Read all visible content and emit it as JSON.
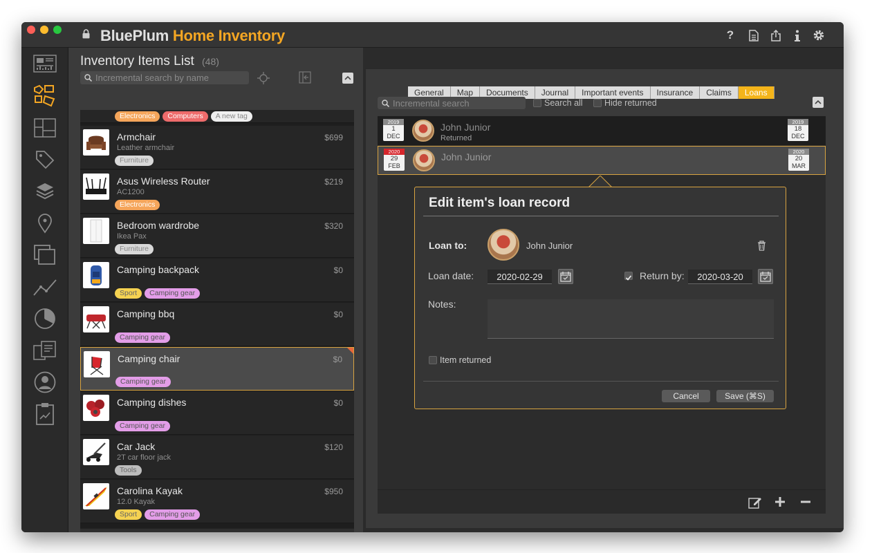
{
  "app": {
    "title_brand": "BluePlum",
    "title_product": "Home Inventory"
  },
  "toolbar": {
    "help_icon": "?"
  },
  "left": {
    "title": "Inventory Items List",
    "count": "(48)",
    "search_placeholder": "Incremental search by name",
    "top_tags": [
      "Electronics",
      "Computers",
      "A new tag"
    ],
    "items": [
      {
        "name": "Armchair",
        "sub": "Leather armchair",
        "price": "$699",
        "tags": [
          "Furniture"
        ]
      },
      {
        "name": "Asus Wireless Router",
        "sub": "AC1200",
        "price": "$219",
        "tags": [
          "Electronics"
        ]
      },
      {
        "name": "Bedroom wardrobe",
        "sub": "Ikea Pax",
        "price": "$320",
        "tags": [
          "Furniture"
        ]
      },
      {
        "name": "Camping backpack",
        "sub": "",
        "price": "$0",
        "tags": [
          "Sport",
          "Camping gear"
        ]
      },
      {
        "name": "Camping bbq",
        "sub": "",
        "price": "$0",
        "tags": [
          "Camping gear"
        ]
      },
      {
        "name": "Camping chair",
        "sub": "",
        "price": "$0",
        "tags": [
          "Camping gear"
        ]
      },
      {
        "name": "Camping dishes",
        "sub": "",
        "price": "$0",
        "tags": [
          "Camping gear"
        ]
      },
      {
        "name": "Car Jack",
        "sub": "2T car floor jack",
        "price": "$120",
        "tags": [
          "Tools"
        ]
      },
      {
        "name": "Carolina Kayak",
        "sub": "12.0 Kayak",
        "price": "$950",
        "tags": [
          "Sport",
          "Camping gear"
        ]
      }
    ]
  },
  "tabs": [
    "General",
    "Map",
    "Documents",
    "Journal",
    "Important events",
    "Insurance",
    "Claims",
    "Loans"
  ],
  "loans": {
    "search_placeholder": "Incremental search",
    "search_all_label": "Search all",
    "hide_returned_label": "Hide returned",
    "rows": [
      {
        "from": {
          "year": "2019",
          "day": "1",
          "month": "DEC"
        },
        "name": "John Junior",
        "status": "Returned",
        "to": {
          "year": "2019",
          "day": "18",
          "month": "DEC"
        }
      },
      {
        "from": {
          "year": "2020",
          "day": "29",
          "month": "FEB"
        },
        "name": "John Junior",
        "status": "",
        "to": {
          "year": "2020",
          "day": "20",
          "month": "MAR"
        }
      }
    ]
  },
  "dialog": {
    "title": "Edit item's loan record",
    "loan_to_label": "Loan to:",
    "loan_to_name": "John Junior",
    "loan_date_label": "Loan date:",
    "loan_date": "2020-02-29",
    "return_by_label": "Return by:",
    "return_by": "2020-03-20",
    "notes_label": "Notes:",
    "item_returned_label": "Item returned",
    "cancel_label": "Cancel",
    "save_label": "Save  (⌘S)"
  },
  "colors": {
    "accent": "#f4a623",
    "selected_border": "#d9a441"
  }
}
